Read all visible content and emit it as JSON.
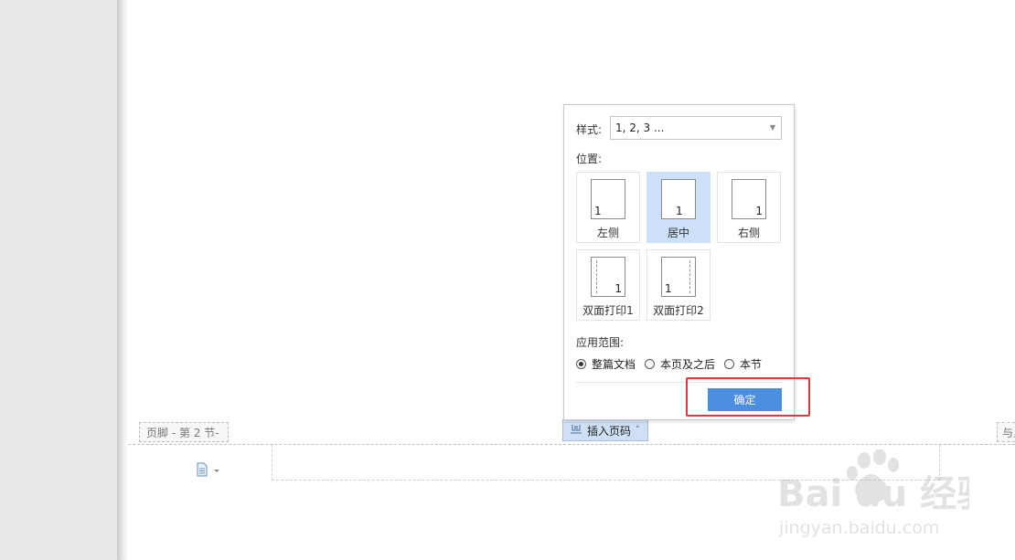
{
  "footer": {
    "label": "页脚  - 第 2 节-",
    "right_tab_label": "与上",
    "doc_icon": "document-icon"
  },
  "insert_page_number": {
    "icon": "page-number-icon",
    "label": "插入页码",
    "chevron": "˄"
  },
  "popup": {
    "style_label": "样式:",
    "style_value": "1, 2, 3 ...",
    "position_label": "位置:",
    "positions": [
      {
        "label": "左侧",
        "number": "1",
        "selected": false
      },
      {
        "label": "居中",
        "number": "1",
        "selected": true
      },
      {
        "label": "右侧",
        "number": "1",
        "selected": false
      },
      {
        "label": "双面打印1",
        "number": "1",
        "selected": false
      },
      {
        "label": "双面打印2",
        "number": "1",
        "selected": false
      }
    ],
    "scope_label": "应用范围:",
    "scope_options": [
      {
        "label": "整篇文档",
        "checked": true
      },
      {
        "label": "本页及之后",
        "checked": false
      },
      {
        "label": "本节",
        "checked": false
      }
    ],
    "ok_label": "确定"
  },
  "colors": {
    "accent": "#4b8fe1",
    "selected_bg": "#cce0f7",
    "highlight": "#e53935"
  },
  "watermark": {
    "brand_text": "Bai du 经验",
    "url_text": "jingyan.baidu.com"
  }
}
